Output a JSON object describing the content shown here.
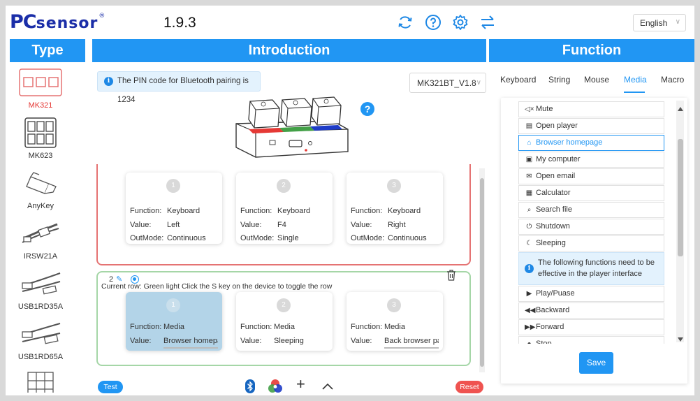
{
  "header": {
    "logo_prefix": "PC",
    "logo_rest": "sensor",
    "logo_mark": "®",
    "version": "1.9.3",
    "icons": [
      "refresh-icon",
      "help-circle-icon",
      "gear-icon",
      "swap-icon"
    ],
    "language": "English"
  },
  "panels": {
    "type_title": "Type",
    "intro_title": "Introduction",
    "function_title": "Function"
  },
  "types": [
    {
      "label": "MK321",
      "active": true
    },
    {
      "label": "MK623",
      "active": false
    },
    {
      "label": "AnyKey",
      "active": false
    },
    {
      "label": "IRSW21A",
      "active": false
    },
    {
      "label": "USB1RD35A",
      "active": false
    },
    {
      "label": "USB1RD65A",
      "active": false
    }
  ],
  "intro": {
    "pin_note": "The PIN code for Bluetooth pairing is 1234",
    "model": "MK321BT_V1.8",
    "help_symbol": "?",
    "device_key_colors": [
      "#e53935",
      "#43a047",
      "#1e3cc8"
    ],
    "row1": {
      "keys": [
        {
          "num": "1",
          "function_label": "Function:",
          "function": "Keyboard",
          "value_label": "Value:",
          "value": "Left",
          "outmode_label": "OutMode:",
          "outmode": "Continuous"
        },
        {
          "num": "2",
          "function_label": "Function:",
          "function": "Keyboard",
          "value_label": "Value:",
          "value": "F4",
          "outmode_label": "OutMode:",
          "outmode": "Single"
        },
        {
          "num": "3",
          "function_label": "Function:",
          "function": "Keyboard",
          "value_label": "Value:",
          "value": "Right",
          "outmode_label": "OutMode:",
          "outmode": "Continuous"
        }
      ]
    },
    "row2": {
      "index": "2",
      "description": "Current row: Green light Click the S key on the device to toggle the row",
      "keys": [
        {
          "num": "1",
          "function_label": "Function:",
          "function": "Media",
          "value_label": "Value:",
          "value": "Browser homepa"
        },
        {
          "num": "2",
          "function_label": "Function:",
          "function": "Media",
          "value_label": "Value:",
          "value": "Sleeping"
        },
        {
          "num": "3",
          "function_label": "Function:",
          "function": "Media",
          "value_label": "Value:",
          "value": "Back browser pa"
        }
      ]
    },
    "bottom": {
      "test_label": "Test",
      "reset_label": "Reset",
      "plus_symbol": "+",
      "up_symbol": "^",
      "test_color": "#2196f3",
      "reset_color": "#ef5350"
    }
  },
  "function": {
    "tabs": [
      "Keyboard",
      "String",
      "Mouse",
      "Media",
      "Macro"
    ],
    "active_tab": "Media",
    "items_before_note": [
      {
        "icon": "◁×",
        "label": "Mute",
        "icon_name": "mute-icon"
      },
      {
        "icon": "▤",
        "label": "Open player",
        "icon_name": "player-icon"
      },
      {
        "icon": "⌂",
        "label": "Browser homepage",
        "icon_name": "home-icon",
        "active": true
      },
      {
        "icon": "▣",
        "label": "My computer",
        "icon_name": "computer-icon"
      },
      {
        "icon": "✉",
        "label": "Open email",
        "icon_name": "email-icon"
      },
      {
        "icon": "▦",
        "label": "Calculator",
        "icon_name": "calculator-icon"
      },
      {
        "icon": "⌕",
        "label": "Search file",
        "icon_name": "search-icon"
      },
      {
        "icon": "⏻",
        "label": "Shutdown",
        "icon_name": "power-icon"
      },
      {
        "icon": "☾",
        "label": "Sleeping",
        "icon_name": "moon-icon"
      }
    ],
    "note": "The following functions need to be effective in the player interface",
    "items_after_note": [
      {
        "icon": "▶",
        "label": "Play/Puase",
        "icon_name": "play-icon"
      },
      {
        "icon": "◀◀",
        "label": "Backward",
        "icon_name": "backward-icon"
      },
      {
        "icon": "▶▶",
        "label": "Forward",
        "icon_name": "forward-icon"
      },
      {
        "icon": "●",
        "label": "Stop",
        "icon_name": "stop-icon"
      }
    ],
    "save_label": "Save"
  },
  "colors": {
    "accent": "#2196f3",
    "logo": "#1b2ea8",
    "active_type": "#e53935",
    "row1_border": "#e57373",
    "row2_border": "#a5d6a7",
    "selected_key": "#b3d4e8"
  }
}
